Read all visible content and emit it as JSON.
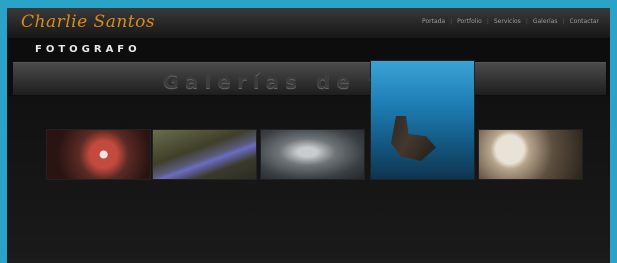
{
  "header": {
    "logo_text": "Charlie Santos",
    "nav": [
      "Portada",
      "Portfolio",
      "Servicios",
      "Galerías",
      "Contactar"
    ]
  },
  "subtitle": "FOTOGRAFO",
  "hero": {
    "title": "Galerías de fotos"
  },
  "gallery": {
    "thumbnails": [
      {
        "name": "gallery-thumb-1"
      },
      {
        "name": "gallery-thumb-2"
      },
      {
        "name": "gallery-thumb-3"
      },
      {
        "name": "gallery-thumb-4"
      },
      {
        "name": "gallery-thumb-5"
      }
    ]
  },
  "colors": {
    "frame": "#2aa3c9",
    "logo": "#d98b1e",
    "background": "#0d0d0d"
  }
}
